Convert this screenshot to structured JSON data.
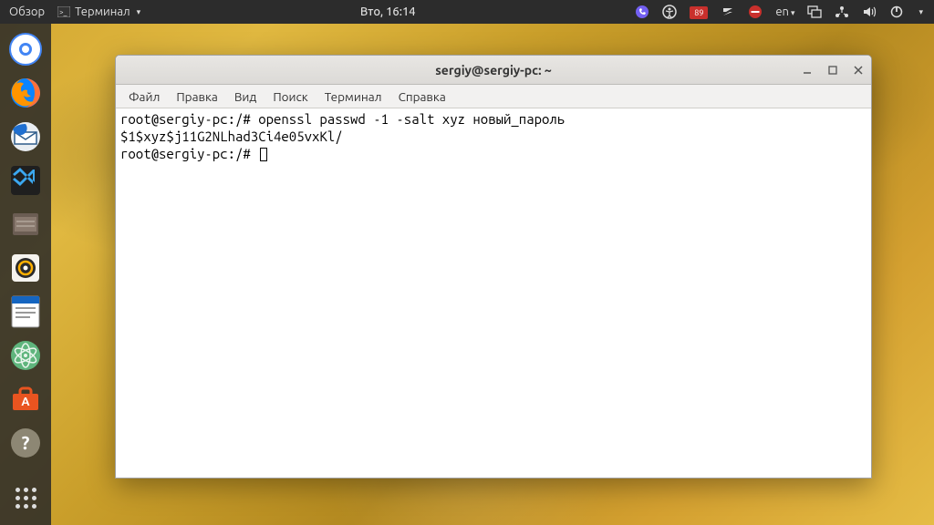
{
  "topbar": {
    "activities": "Обзор",
    "app_menu": "Терминал",
    "clock": "Вто, 16:14",
    "lang": "en",
    "badge": "89"
  },
  "dock": {
    "items": [
      {
        "name": "chromium",
        "bg": "#ffffff",
        "hint": "C"
      },
      {
        "name": "firefox",
        "bg": "#ff7139",
        "hint": "F"
      },
      {
        "name": "thunderbird",
        "bg": "#eaeef2",
        "hint": "M"
      },
      {
        "name": "vscode",
        "bg": "#1f1f1f",
        "hint": "V"
      },
      {
        "name": "files",
        "bg": "#8a7a6f",
        "hint": "N"
      },
      {
        "name": "media",
        "bg": "#f5f3ee",
        "hint": "P"
      },
      {
        "name": "writer",
        "bg": "#ffffff",
        "hint": "W"
      },
      {
        "name": "atom",
        "bg": "#5fb57d",
        "hint": "A"
      },
      {
        "name": "software",
        "bg": "#e95420",
        "hint": "S"
      },
      {
        "name": "help",
        "bg": "#8d8774",
        "hint": "?"
      }
    ]
  },
  "window": {
    "title": "sergiy@sergiy-pc: ~",
    "menu": {
      "file": "Файл",
      "edit": "Правка",
      "view": "Вид",
      "search": "Поиск",
      "terminal": "Терминал",
      "help": "Справка"
    },
    "terminal": {
      "line1_prompt": "root@sergiy-pc:/# ",
      "line1_cmd": "openssl passwd -1 -salt xyz новый_пароль",
      "line2": "$1$xyz$j11G2NLhad3Ci4e05vxKl/",
      "line3_prompt": "root@sergiy-pc:/# "
    }
  }
}
